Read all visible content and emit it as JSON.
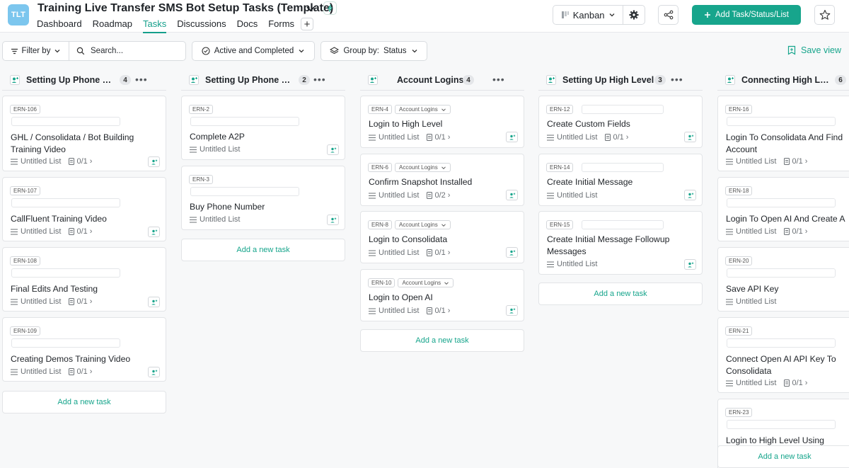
{
  "project": {
    "logo_text": "TLT",
    "title": "Training Live Transfer SMS Bot Setup Tasks (Template)"
  },
  "nav": {
    "tabs": [
      {
        "label": "Dashboard"
      },
      {
        "label": "Roadmap"
      },
      {
        "label": "Tasks",
        "active": true
      },
      {
        "label": "Discussions"
      },
      {
        "label": "Docs"
      },
      {
        "label": "Forms"
      }
    ],
    "plus": "+"
  },
  "header_actions": {
    "view_label": "Kanban",
    "add_label": "Add Task/Status/List"
  },
  "toolbar": {
    "filter_label": "Filter by",
    "search_placeholder": "Search...",
    "status_filter_label": "Active and Completed",
    "group_by_label": "Group by:",
    "group_by_value": "Status",
    "save_view_label": "Save view"
  },
  "board": {
    "add_task_label": "Add a new task",
    "columns": [
      {
        "name": "Setting Up Phone N...",
        "count": "4",
        "cards": [
          {
            "id": "ERN-106",
            "title": "GHL / Consolidata / Bot Building Training Video",
            "list": "Untitled List",
            "subtasks": "0/1"
          },
          {
            "id": "ERN-107",
            "title": "CallFluent Training Video",
            "list": "Untitled List",
            "subtasks": "0/1"
          },
          {
            "id": "ERN-108",
            "title": "Final Edits And Testing",
            "list": "Untitled List",
            "subtasks": "0/1"
          },
          {
            "id": "ERN-109",
            "title": "Creating Demos Training Video",
            "list": "Untitled List",
            "subtasks": "0/1"
          }
        ]
      },
      {
        "name": "Setting Up Phone N...",
        "count": "2",
        "cards": [
          {
            "id": "ERN-2",
            "title": "Complete A2P",
            "list": "Untitled List"
          },
          {
            "id": "ERN-3",
            "title": "Buy Phone Number",
            "list": "Untitled List"
          }
        ]
      },
      {
        "name": "Account Logins",
        "count": "4",
        "cards": [
          {
            "id": "ERN-4",
            "chip": "Account Logins",
            "title": "Login to High Level",
            "list": "Untitled List",
            "subtasks": "0/1"
          },
          {
            "id": "ERN-6",
            "chip": "Account Logins",
            "title": "Confirm Snapshot Installed",
            "list": "Untitled List",
            "subtasks": "0/2"
          },
          {
            "id": "ERN-8",
            "chip": "Account Logins",
            "title": "Login to Consolidata",
            "list": "Untitled List",
            "subtasks": "0/1"
          },
          {
            "id": "ERN-10",
            "chip": "Account Logins",
            "title": "Login to Open AI",
            "list": "Untitled List",
            "subtasks": "0/1"
          }
        ]
      },
      {
        "name": "Setting Up High Level",
        "count": "3",
        "cards": [
          {
            "id": "ERN-12",
            "title": "Create Custom Fields",
            "list": "Untitled List",
            "subtasks": "0/1"
          },
          {
            "id": "ERN-14",
            "title": "Create Initial Message",
            "list": "Untitled List"
          },
          {
            "id": "ERN-15",
            "title": "Create Initial Message Followup Messages",
            "list": "Untitled List"
          }
        ]
      },
      {
        "name": "Connecting High Le...",
        "count": "6",
        "cards": [
          {
            "id": "ERN-16",
            "title": "Login To Consolidata And Find Account",
            "list": "Untitled List",
            "subtasks": "0/1"
          },
          {
            "id": "ERN-18",
            "title": "Login To Open AI And Create A",
            "list": "Untitled List",
            "subtasks": "0/1"
          },
          {
            "id": "ERN-20",
            "title": "Save API Key",
            "list": "Untitled List"
          },
          {
            "id": "ERN-21",
            "title": "Connect Open AI API Key To Consolidata",
            "list": "Untitled List",
            "subtasks": "0/1"
          },
          {
            "id": "ERN-23",
            "title": "Login to High Level Using"
          }
        ]
      }
    ]
  }
}
